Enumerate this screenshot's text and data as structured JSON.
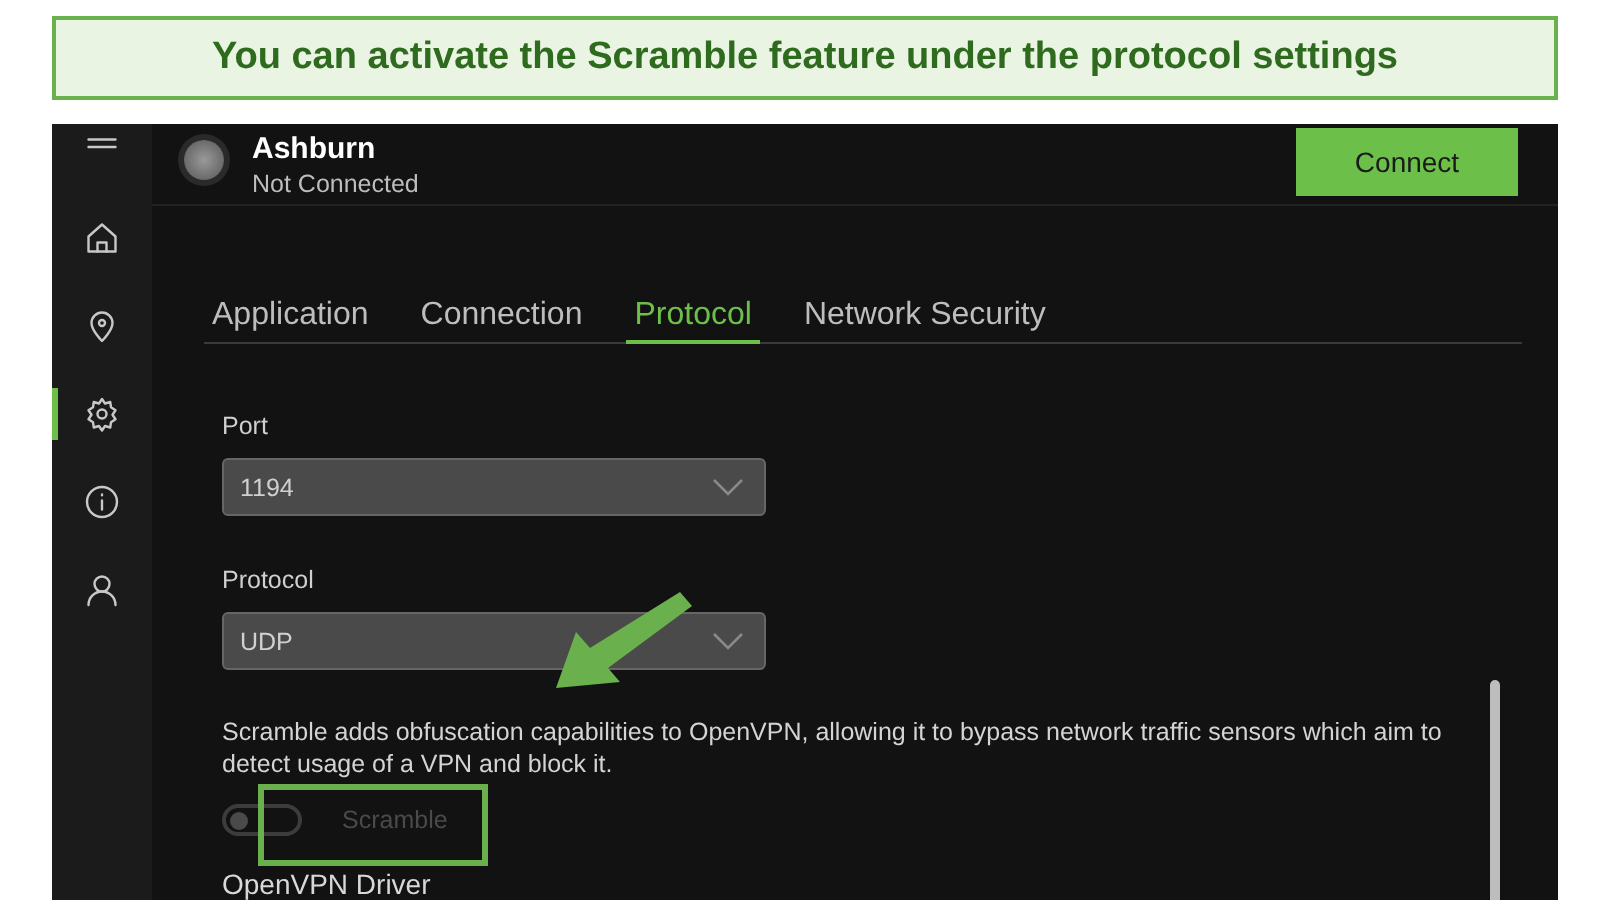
{
  "banner": {
    "text": "You can activate the Scramble feature under the protocol settings"
  },
  "sidebar": {
    "items": [
      {
        "kind": "menu",
        "selected": false
      },
      {
        "kind": "home",
        "selected": false
      },
      {
        "kind": "pin",
        "selected": false
      },
      {
        "kind": "gear",
        "selected": true
      },
      {
        "kind": "info",
        "selected": false
      },
      {
        "kind": "user",
        "selected": false
      }
    ]
  },
  "server": {
    "name": "Ashburn",
    "status": "Not Connected",
    "connected": false
  },
  "connect_button": "Connect",
  "tabs": [
    {
      "label": "Application",
      "selected": false
    },
    {
      "label": "Connection",
      "selected": false
    },
    {
      "label": "Protocol",
      "selected": true
    },
    {
      "label": "Network Security",
      "selected": false
    }
  ],
  "fields": [
    {
      "label": "Port",
      "value": "1194"
    },
    {
      "label": "Protocol",
      "value": "UDP"
    }
  ],
  "scramble": {
    "description": "Scramble adds obfuscation capabilities to OpenVPN, allowing it to bypass network traffic sensors which aim to detect usage of a VPN and block it.",
    "label": "Scramble",
    "on": false,
    "disabled": true
  },
  "section_heading": "OpenVPN Driver"
}
